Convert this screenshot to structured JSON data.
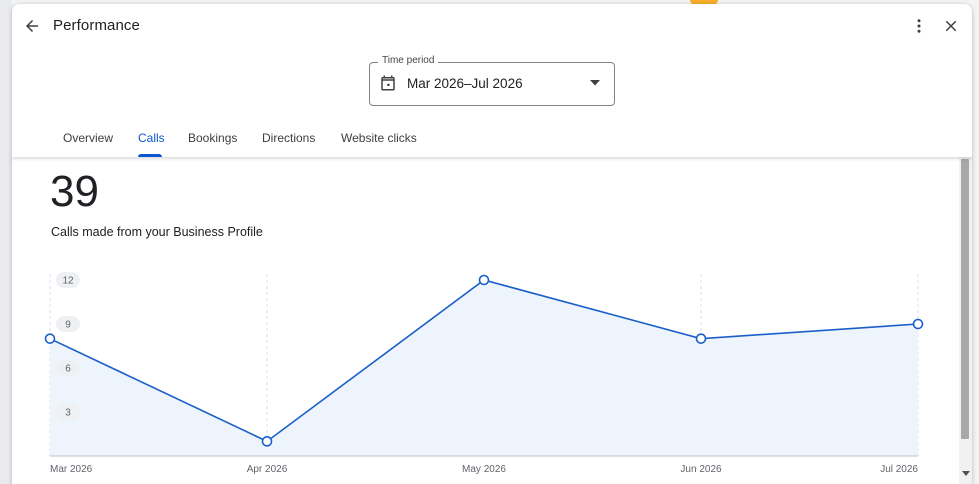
{
  "dialog": {
    "title": "Performance",
    "time_period": {
      "label": "Time period",
      "value": "Mar 2026–Jul 2026"
    },
    "tabs": [
      {
        "label": "Overview",
        "active": false
      },
      {
        "label": "Calls",
        "active": true
      },
      {
        "label": "Bookings",
        "active": false
      },
      {
        "label": "Directions",
        "active": false
      },
      {
        "label": "Website clicks",
        "active": false
      }
    ]
  },
  "metric": {
    "value": "39",
    "description": "Calls made from your Business Profile"
  },
  "colors": {
    "accent": "#0b57d0",
    "line": "#1a5fc8",
    "area": "#eef4fc"
  },
  "chart_data": {
    "type": "line",
    "categories": [
      "Mar 2026",
      "Apr 2026",
      "May 2026",
      "Jun 2026",
      "Jul 2026"
    ],
    "values": [
      8,
      1,
      12,
      8,
      9
    ],
    "y_ticks": [
      3,
      6,
      9,
      12
    ],
    "ylim": [
      0,
      12
    ],
    "grid": "vertical dashed",
    "area_fill": true
  }
}
